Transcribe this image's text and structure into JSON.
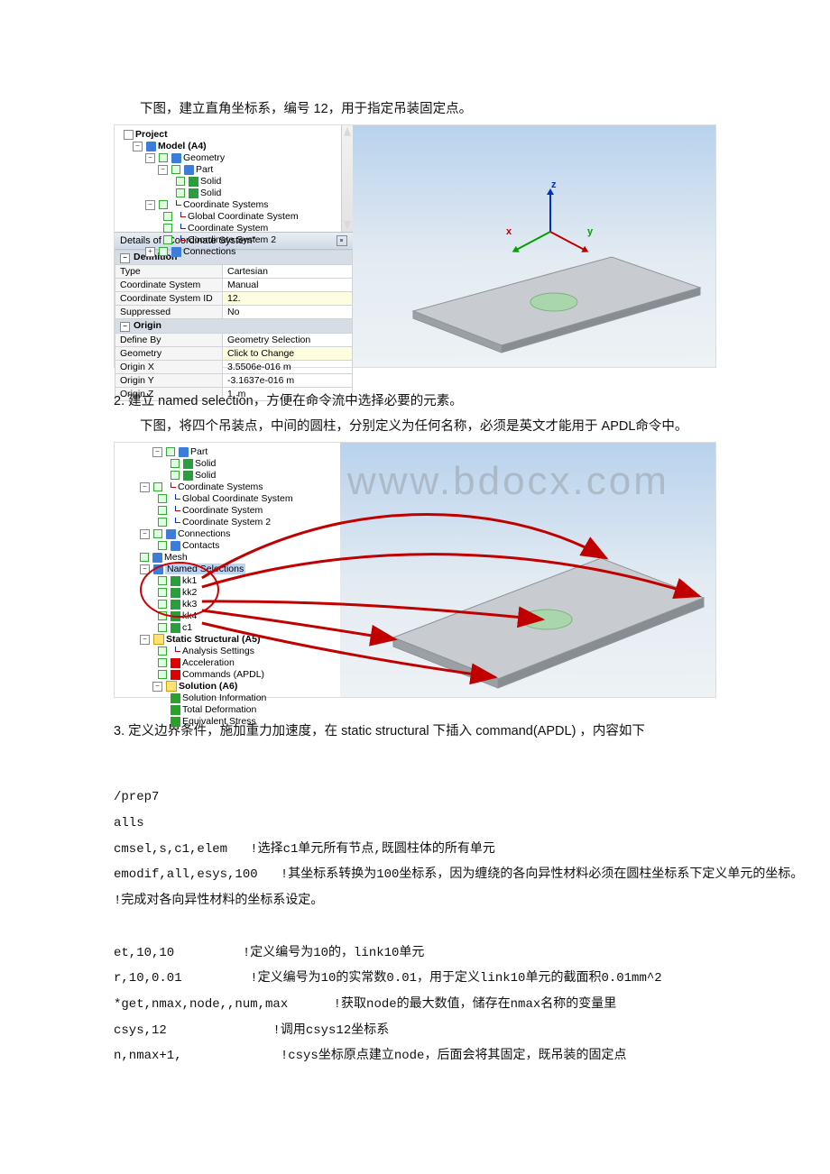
{
  "para1": "下图，建立直角坐标系，编号 12，用于指定吊装固定点。",
  "fig1": {
    "tree": {
      "project": "Project",
      "model": "Model (A4)",
      "geometry": "Geometry",
      "part": "Part",
      "solid1": "Solid",
      "solid2": "Solid",
      "csystems": "Coordinate Systems",
      "gcs": "Global Coordinate System",
      "cs1": "Coordinate System",
      "cs2": "Coordinate System 2",
      "connections": "Connections"
    },
    "details_title": "Details of \"Coordinate System\"",
    "sections": {
      "definition": "Definition",
      "origin": "Origin"
    },
    "rows": {
      "type_l": "Type",
      "type_v": "Cartesian",
      "cs_l": "Coordinate System",
      "cs_v": "Manual",
      "csid_l": "Coordinate System ID",
      "csid_v": "12.",
      "sup_l": "Suppressed",
      "sup_v": "No",
      "def_l": "Define By",
      "def_v": "Geometry Selection",
      "geo_l": "Geometry",
      "geo_v": "Click to Change",
      "ox_l": "Origin X",
      "ox_v": "3.5506e-016 m",
      "oy_l": "Origin Y",
      "oy_v": "-3.1637e-016 m",
      "oz_l": "Origin Z",
      "oz_v": "1. m"
    },
    "axes": {
      "x": "x",
      "y": "y",
      "z": "z"
    }
  },
  "para2a": "2.  建立 named selection，方便在命令流中选择必要的元素。",
  "para2b": "下图，将四个吊装点，中间的圆柱，分别定义为任何名称，必须是英文才能用于 APDL命令中。",
  "fig2": {
    "tree": {
      "part": "Part",
      "solid1": "Solid",
      "solid2": "Solid",
      "csystems": "Coordinate Systems",
      "gcs": "Global Coordinate System",
      "cs1": "Coordinate System",
      "cs2": "Coordinate System 2",
      "connections": "Connections",
      "contacts": "Contacts",
      "mesh": "Mesh",
      "ns": "Named Selections",
      "kk1": "kk1",
      "kk2": "kk2",
      "kk3": "kk3",
      "kk4": "kk4",
      "c1": "c1",
      "ss": "Static Structural (A5)",
      "as": "Analysis Settings",
      "acc": "Acceleration",
      "cmd": "Commands (APDL)",
      "sol": "Solution (A6)",
      "si": "Solution Information",
      "td": "Total Deformation",
      "es": "Equivalent Stress"
    },
    "watermark": "www.bdocx.com"
  },
  "para3": "3.  定义边界条件，施加重力加速度，在 static structural  下插入 command(APDL)  ，内容如下",
  "code": {
    "l1": "/prep7",
    "l2": "alls",
    "l3": "cmsel,s,c1,elem   !选择c1单元所有节点,既圆柱体的所有单元",
    "l4": "emodif,all,esys,100   !其坐标系转换为100坐标系，因为缠绕的各向异性材料必须在圆柱坐标系下定义单元的坐标。",
    "l5": "!完成对各向异性材料的坐标系设定。",
    "l6": "",
    "l7": "et,10,10         !定义编号为10的，link10单元",
    "l8": "r,10,0.01         !定义编号为10的实常数0.01，用于定义link10单元的截面积0.01mm^2",
    "l9": "*get,nmax,node,,num,max      !获取node的最大数值，储存在nmax名称的变量里",
    "l10": "csys,12              !调用csys12坐标系",
    "l11": "n,nmax+1,             !csys坐标原点建立node，后面会将其固定，既吊装的固定点"
  }
}
